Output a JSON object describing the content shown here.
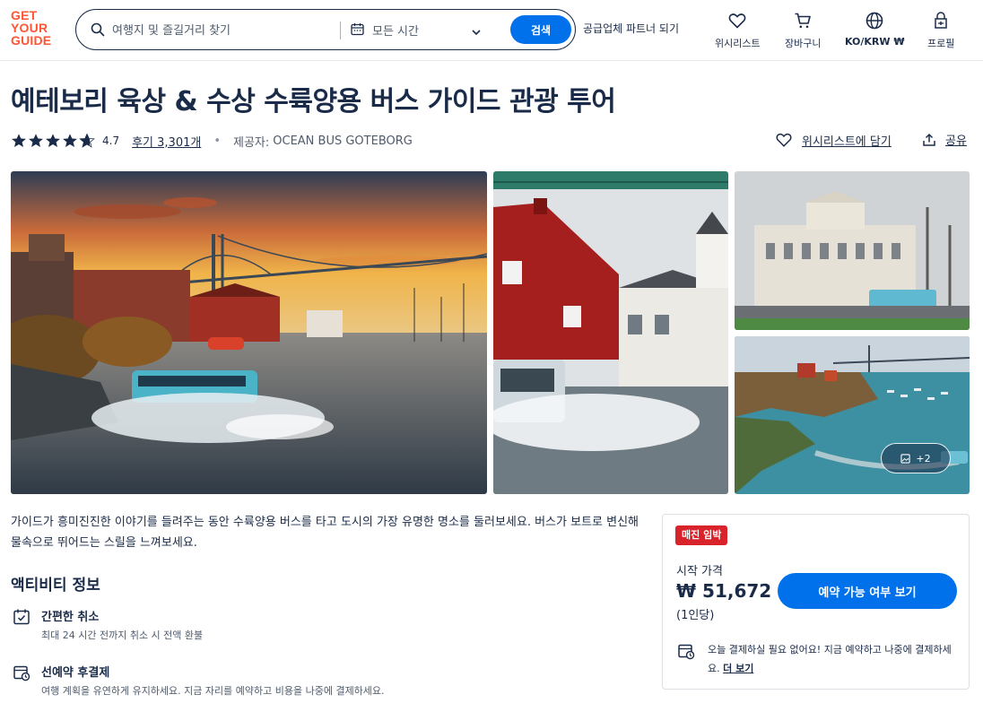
{
  "header": {
    "logo_lines": [
      "GET",
      "YOUR",
      "GUIDE"
    ],
    "search_placeholder": "여행지 및 즐길거리 찾기",
    "date_label": "모든 시간",
    "search_button": "검색",
    "partner_link": "공급업체 파트너 되기",
    "nav": {
      "wishlist": "위시리스트",
      "cart": "장바구니",
      "language": "KO/KRW ₩",
      "profile": "프로필"
    }
  },
  "product": {
    "title": "예테보리 육상 & 수상 수륙양용 버스 가이드 관광 투어",
    "rating": "4.7",
    "rating_value": 4.7,
    "reviews": "후기 3,301개",
    "provider_label": "제공자:",
    "provider_name": "OCEAN BUS GOTEBORG",
    "wishlist_add": "위시리스트에 담기",
    "share": "공유"
  },
  "gallery": {
    "more_count": "+2"
  },
  "description": "가이드가 흥미진진한 이야기를 들려주는 동안 수륙양용 버스를 타고 도시의 가장 유명한 명소를 둘러보세요. 버스가 보트로 변신해 물속으로 뛰어드는 스릴을 느껴보세요.",
  "activity_info": {
    "title": "액티비티 정보",
    "items": [
      {
        "title": "간편한 취소",
        "desc": "최대 24 시간 전까지 취소 시 전액 환불"
      },
      {
        "title": "선예약 후결제",
        "desc": "여행 계획을 유연하게 유지하세요. 지금 자리를 예약하고 비용을 나중에 결제하세요."
      }
    ]
  },
  "booking": {
    "badge": "매진 임박",
    "from_label": "시작 가격",
    "price": "₩ 51,672",
    "per_person": "(1인당)",
    "check_button": "예약 가능 여부 보기",
    "pay_later_text": "오늘 결제하실 필요 없어요! 지금 예약하고 나중에 결제하세요.",
    "more_link": "더 보기"
  },
  "colors": {
    "brand_orange": "#ff5533",
    "primary_blue": "#0071eb",
    "text_dark": "#1a2b49",
    "badge_red": "#d8232a"
  }
}
